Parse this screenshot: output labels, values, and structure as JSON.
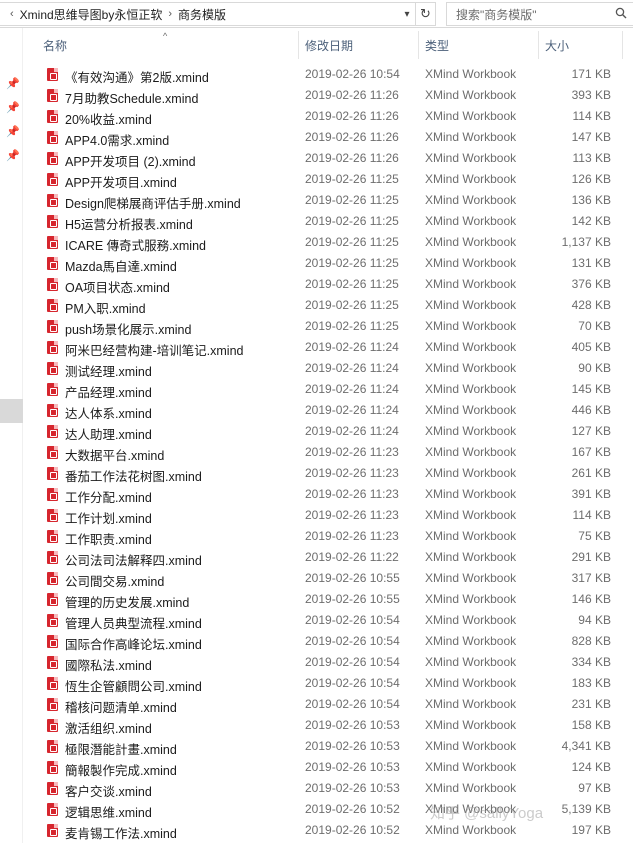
{
  "address": {
    "segments": [
      "Xmind思维导图by永恒正软",
      "商务模版"
    ]
  },
  "search": {
    "placeholder": "搜索\"商务模版\""
  },
  "columns": {
    "name": "名称",
    "date": "修改日期",
    "type": "类型",
    "size": "大小"
  },
  "files": [
    {
      "name": "《有效沟通》第2版.xmind",
      "date": "2019-02-26 10:54",
      "type": "XMind Workbook",
      "size": "171 KB"
    },
    {
      "name": "7月助教Schedule.xmind",
      "date": "2019-02-26 11:26",
      "type": "XMind Workbook",
      "size": "393 KB"
    },
    {
      "name": "20%收益.xmind",
      "date": "2019-02-26 11:26",
      "type": "XMind Workbook",
      "size": "114 KB"
    },
    {
      "name": "APP4.0需求.xmind",
      "date": "2019-02-26 11:26",
      "type": "XMind Workbook",
      "size": "147 KB"
    },
    {
      "name": "APP开发项目 (2).xmind",
      "date": "2019-02-26 11:26",
      "type": "XMind Workbook",
      "size": "113 KB"
    },
    {
      "name": "APP开发项目.xmind",
      "date": "2019-02-26 11:25",
      "type": "XMind Workbook",
      "size": "126 KB"
    },
    {
      "name": "Design爬梯展商评估手册.xmind",
      "date": "2019-02-26 11:25",
      "type": "XMind Workbook",
      "size": "136 KB"
    },
    {
      "name": "H5运营分析报表.xmind",
      "date": "2019-02-26 11:25",
      "type": "XMind Workbook",
      "size": "142 KB"
    },
    {
      "name": "ICARE 傳奇式服務.xmind",
      "date": "2019-02-26 11:25",
      "type": "XMind Workbook",
      "size": "1,137 KB"
    },
    {
      "name": "Mazda馬自達.xmind",
      "date": "2019-02-26 11:25",
      "type": "XMind Workbook",
      "size": "131 KB"
    },
    {
      "name": "OA项目状态.xmind",
      "date": "2019-02-26 11:25",
      "type": "XMind Workbook",
      "size": "376 KB"
    },
    {
      "name": "PM入职.xmind",
      "date": "2019-02-26 11:25",
      "type": "XMind Workbook",
      "size": "428 KB"
    },
    {
      "name": "push场景化展示.xmind",
      "date": "2019-02-26 11:25",
      "type": "XMind Workbook",
      "size": "70 KB"
    },
    {
      "name": "阿米巴经营构建-培训笔记.xmind",
      "date": "2019-02-26 11:24",
      "type": "XMind Workbook",
      "size": "405 KB"
    },
    {
      "name": "测试经理.xmind",
      "date": "2019-02-26 11:24",
      "type": "XMind Workbook",
      "size": "90 KB"
    },
    {
      "name": "产品经理.xmind",
      "date": "2019-02-26 11:24",
      "type": "XMind Workbook",
      "size": "145 KB"
    },
    {
      "name": "达人体系.xmind",
      "date": "2019-02-26 11:24",
      "type": "XMind Workbook",
      "size": "446 KB"
    },
    {
      "name": "达人助理.xmind",
      "date": "2019-02-26 11:24",
      "type": "XMind Workbook",
      "size": "127 KB"
    },
    {
      "name": "大数据平台.xmind",
      "date": "2019-02-26 11:23",
      "type": "XMind Workbook",
      "size": "167 KB"
    },
    {
      "name": "番茄工作法花树图.xmind",
      "date": "2019-02-26 11:23",
      "type": "XMind Workbook",
      "size": "261 KB"
    },
    {
      "name": "工作分配.xmind",
      "date": "2019-02-26 11:23",
      "type": "XMind Workbook",
      "size": "391 KB"
    },
    {
      "name": "工作计划.xmind",
      "date": "2019-02-26 11:23",
      "type": "XMind Workbook",
      "size": "114 KB"
    },
    {
      "name": "工作职责.xmind",
      "date": "2019-02-26 11:23",
      "type": "XMind Workbook",
      "size": "75 KB"
    },
    {
      "name": "公司法司法解释四.xmind",
      "date": "2019-02-26 11:22",
      "type": "XMind Workbook",
      "size": "291 KB"
    },
    {
      "name": "公司間交易.xmind",
      "date": "2019-02-26 10:55",
      "type": "XMind Workbook",
      "size": "317 KB"
    },
    {
      "name": "管理的历史发展.xmind",
      "date": "2019-02-26 10:55",
      "type": "XMind Workbook",
      "size": "146 KB"
    },
    {
      "name": "管理人员典型流程.xmind",
      "date": "2019-02-26 10:54",
      "type": "XMind Workbook",
      "size": "94 KB"
    },
    {
      "name": "国际合作高峰论坛.xmind",
      "date": "2019-02-26 10:54",
      "type": "XMind Workbook",
      "size": "828 KB"
    },
    {
      "name": "國際私法.xmind",
      "date": "2019-02-26 10:54",
      "type": "XMind Workbook",
      "size": "334 KB"
    },
    {
      "name": "恆生企管顧問公司.xmind",
      "date": "2019-02-26 10:54",
      "type": "XMind Workbook",
      "size": "183 KB"
    },
    {
      "name": "稽核问题清单.xmind",
      "date": "2019-02-26 10:54",
      "type": "XMind Workbook",
      "size": "231 KB"
    },
    {
      "name": "激活组织.xmind",
      "date": "2019-02-26 10:53",
      "type": "XMind Workbook",
      "size": "158 KB"
    },
    {
      "name": "極限潛能計畫.xmind",
      "date": "2019-02-26 10:53",
      "type": "XMind Workbook",
      "size": "4,341 KB"
    },
    {
      "name": "簡報製作完成.xmind",
      "date": "2019-02-26 10:53",
      "type": "XMind Workbook",
      "size": "124 KB"
    },
    {
      "name": "客户交谈.xmind",
      "date": "2019-02-26 10:53",
      "type": "XMind Workbook",
      "size": "97 KB"
    },
    {
      "name": "逻辑思维.xmind",
      "date": "2019-02-26 10:52",
      "type": "XMind Workbook",
      "size": "5,139 KB"
    },
    {
      "name": "麦肯锡工作法.xmind",
      "date": "2019-02-26 10:52",
      "type": "XMind Workbook",
      "size": "197 KB"
    }
  ],
  "watermark": "知乎 @sallyYoga",
  "colors": {
    "file_icon": "#d6262e",
    "header_text": "#4c607a",
    "meta_text": "#6d6d6d"
  }
}
